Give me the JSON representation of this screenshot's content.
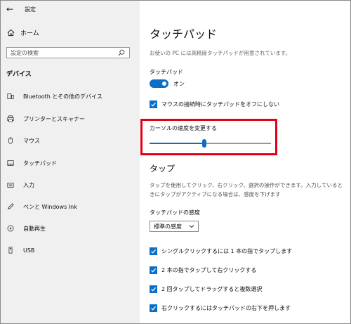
{
  "sidebar": {
    "back_glyph": "←",
    "app_title": "設定",
    "home": {
      "icon": "home-icon",
      "label": "ホーム"
    },
    "search": {
      "placeholder": "設定の検索",
      "icon": "search-icon"
    },
    "section_header": "デバイス",
    "items": [
      {
        "icon": "bluetooth-icon",
        "label": "Bluetooth とその他のデバイス"
      },
      {
        "icon": "printer-icon",
        "label": "プリンターとスキャナー"
      },
      {
        "icon": "mouse-icon",
        "label": "マウス"
      },
      {
        "icon": "touchpad-icon",
        "label": "タッチパッド"
      },
      {
        "icon": "keyboard-icon",
        "label": "入力"
      },
      {
        "icon": "pen-icon",
        "label": "ペンと Windows Ink"
      },
      {
        "icon": "autoplay-icon",
        "label": "自動再生"
      },
      {
        "icon": "usb-icon",
        "label": "USB"
      }
    ]
  },
  "main": {
    "title": "タッチパッド",
    "subtitle": "お使いの PC には高精度タッチパッドが用意されています。",
    "touchpad_label": "タッチパッド",
    "toggle_state": "オン",
    "toggle_on": true,
    "mouse_connected_option": "マウスの接続時にタッチパッドをオフにしない",
    "cursor_speed_label": "カーソルの速度を変更する",
    "cursor_speed_value": 0.45,
    "taps_title": "タップ",
    "taps_description": "タップを使用してクリック、右クリック、選択の操作ができます。入力していると きにタップがアクティブになる場合は、感度を下げます",
    "sensitivity_label": "タッチパッドの感度",
    "sensitivity_value": "標準の感度",
    "tap_options": [
      "シングルクリックするには 1 本の指でタップします",
      "2 本の指でタップして右クリックする",
      "2 回タップしてドラッグすると複数選択",
      "右クリックするにはタッチパッドの右下を押します"
    ]
  },
  "colors": {
    "accent": "#0b6fc6",
    "highlight": "#e3001b",
    "sidebar_bg": "#f0f0f0"
  }
}
